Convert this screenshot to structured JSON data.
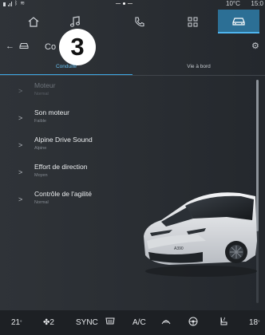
{
  "status_bar": {
    "temperature": "10°C",
    "clock": "15:0"
  },
  "nav": {
    "tabs": [
      {
        "icon": "home-icon"
      },
      {
        "icon": "music-note-icon"
      },
      {
        "icon": "phone-icon"
      },
      {
        "icon": "apps-grid-icon"
      },
      {
        "icon": "car-icon",
        "active": true
      }
    ]
  },
  "header": {
    "title": "Co",
    "callout_number": "3"
  },
  "tabs": {
    "driving": "Conduite",
    "onboard_life": "Vie à bord"
  },
  "settings": {
    "items": [
      {
        "title": "Moteur",
        "value": "Normal",
        "enabled": false
      },
      {
        "title": "Son moteur",
        "value": "Faible",
        "enabled": true
      },
      {
        "title": "Alpine Drive Sound",
        "value": "Alpine",
        "enabled": true
      },
      {
        "title": "Effort de direction",
        "value": "Moyen",
        "enabled": true
      },
      {
        "title": "Contrôle de l'agilité",
        "value": "Normal",
        "enabled": true
      }
    ]
  },
  "car": {
    "badge": "A390"
  },
  "climate": {
    "left_temp": "21",
    "left_temp_unit": "°",
    "fan_level": "2",
    "sync_label": "SYNC",
    "ac_label": "A/C",
    "right_temp": "18",
    "right_temp_unit": "°"
  },
  "colors": {
    "accent": "#3da7e3",
    "active_nav": "#2c6f95",
    "background": "#2d3136"
  }
}
